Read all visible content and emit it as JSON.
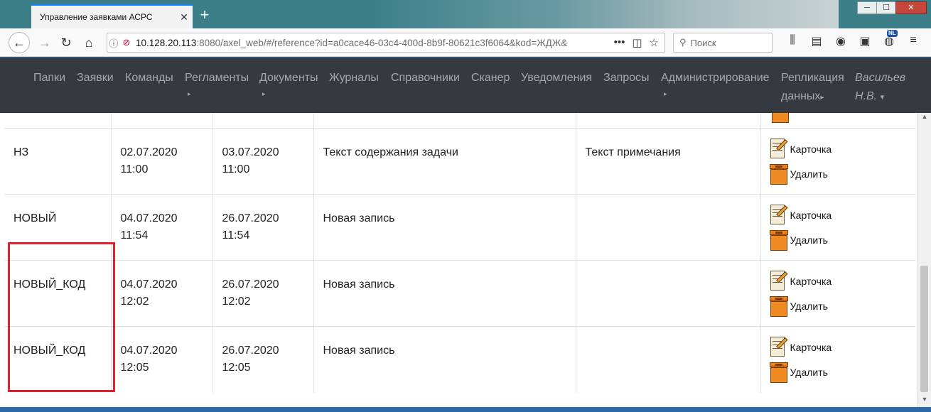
{
  "browser": {
    "tab_title": "Управление заявками АСРС",
    "tab_close": "✕",
    "new_tab": "+",
    "url_host": "10.128.20.113",
    "url_path": ":8080/axel_web/#/reference?id=a0cace46-03c4-400d-8b9f-80621c3f6064&kod=ЖДЖ&",
    "search_placeholder": "Поиск",
    "nl_badge": "NL"
  },
  "menu": {
    "items": [
      {
        "label": "Папки"
      },
      {
        "label": "Заявки"
      },
      {
        "label": "Команды"
      },
      {
        "label": "Регламенты"
      },
      {
        "label": "Документы"
      },
      {
        "label": "Журналы"
      },
      {
        "label": "Справочники"
      },
      {
        "label": "Сканер"
      },
      {
        "label": "Уведомления"
      },
      {
        "label": "Запросы"
      },
      {
        "label": "Администрирование"
      },
      {
        "label": "Репликация"
      },
      {
        "label": "данных"
      }
    ],
    "user_line1": "Васильев",
    "user_line2": "Н.В.",
    "caret_right": "▸",
    "caret_down": "▾"
  },
  "table": {
    "rows": [
      {
        "code": "НЗ",
        "start_date": "02.07.2020",
        "start_time": "11:00",
        "end_date": "03.07.2020",
        "end_time": "11:00",
        "content": "Текст содержания задачи",
        "note": "Текст примечания"
      },
      {
        "code": "НОВЫЙ",
        "start_date": "04.07.2020",
        "start_time": "11:54",
        "end_date": "26.07.2020",
        "end_time": "11:54",
        "content": "Новая запись",
        "note": ""
      },
      {
        "code": "НОВЫЙ_КОД",
        "start_date": "04.07.2020",
        "start_time": "12:02",
        "end_date": "26.07.2020",
        "end_time": "12:02",
        "content": "Новая запись",
        "note": ""
      },
      {
        "code": "НОВЫЙ_КОД",
        "start_date": "04.07.2020",
        "start_time": "12:05",
        "end_date": "26.07.2020",
        "end_time": "12:05",
        "content": "Новая запись",
        "note": ""
      }
    ],
    "action_card": "Карточка",
    "action_delete": "Удалить"
  },
  "colors": {
    "highlight": "#e0202a",
    "menu_bg": "#343a40",
    "bin": "#f08a22"
  }
}
